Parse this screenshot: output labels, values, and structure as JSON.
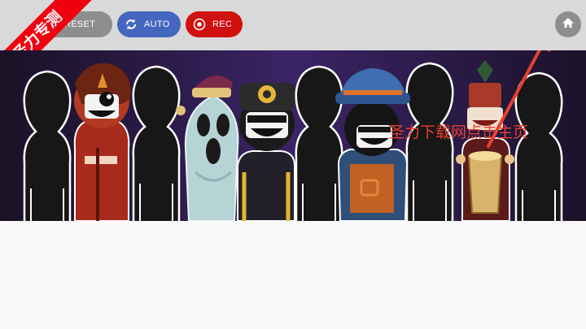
{
  "toolbar": {
    "reset_label": "RESET",
    "auto_label": "AUTO",
    "rec_label": "REC"
  },
  "banner": {
    "text": "圣力专测"
  },
  "overlay": {
    "caption": "圣力下载网点击主页"
  },
  "colors": {
    "topbar": "#d9d9d9",
    "reset": "#8e8e8e",
    "auto": "#4566be",
    "rec": "#d11010",
    "home": "#8d8d8d",
    "banner": "#f10010",
    "stage": "#2a1a45",
    "arrow": "#e8402f"
  },
  "icons": {
    "reset": "reset-icon",
    "auto": "refresh-icon",
    "rec": "record-icon",
    "home": "home-icon"
  },
  "stage": {
    "slots": [
      "empty",
      "character-red-dreads",
      "empty",
      "character-ghost-beanie",
      "character-police-cap",
      "empty",
      "character-blue-bucket-hat",
      "empty",
      "character-drummer",
      "empty"
    ]
  }
}
